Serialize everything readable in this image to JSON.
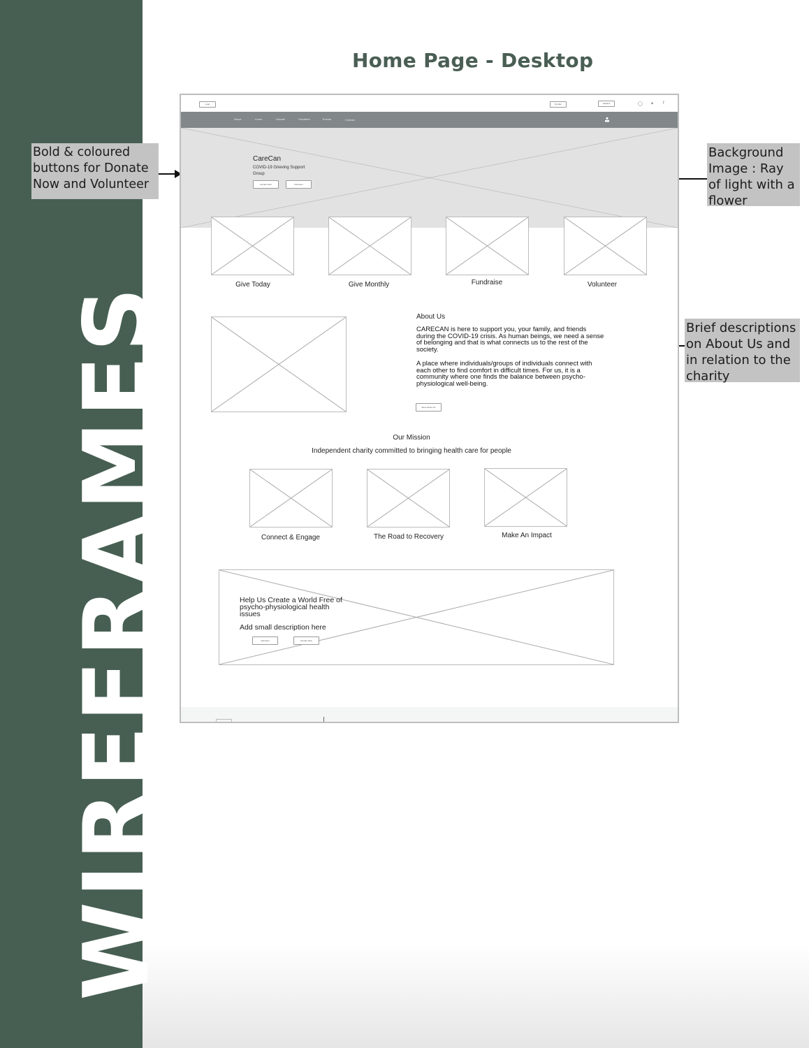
{
  "sidebar": {
    "word": "WIREFRAMES",
    "color": "#475f52"
  },
  "page_title": "Home Page - Desktop",
  "annotations": {
    "buttons_note": "Bold & coloured buttons for Donate Now and Volunteer",
    "background_note": "Background Image : Ray of light with a flower",
    "about_note": "Brief descriptions on About Us and in relation to the charity"
  },
  "wireframe": {
    "header": {
      "logo_label": "Logo",
      "donate_label": "Donate",
      "helpline_label": "Helpline",
      "social_icons": [
        "instagram-icon",
        "twitter-icon",
        "facebook-icon"
      ]
    },
    "nav": {
      "items": [
        "About",
        "Learn",
        "Donate",
        "Volunteer",
        "Events",
        "Contact"
      ]
    },
    "hero": {
      "title": "CareCan",
      "subtitle": "COVID-19 Grieving Support Group",
      "donate_btn": "Donate Now",
      "volunteer_btn": "Volunteer"
    },
    "cards": [
      {
        "label": "Give Today"
      },
      {
        "label": "Give Monthly"
      },
      {
        "label": "Fundraise"
      },
      {
        "label": "Volunteer"
      }
    ],
    "about": {
      "title": "About Us",
      "p1": "CARECAN is here to support you, your family, and friends during the COVID-19 crisis. As human beings, we need a sense of belonging and that is what connects us to the rest of the society.",
      "p2": "A place where individuals/groups of individuals connect with each other to find comfort in difficult times. For us, it is a community where one finds the balance between psycho-physiological well-being.",
      "more_btn": "More About Us"
    },
    "mission": {
      "title": "Our Mission",
      "subtitle": "Independent charity committed to bringing health care for people",
      "items": [
        {
          "label": "Connect & Engage"
        },
        {
          "label": "The Road to Recovery"
        },
        {
          "label": "Make An Impact"
        }
      ]
    },
    "cta": {
      "title": "Help Us Create a World Free of psycho-physiological health issues",
      "description": "Add small description here",
      "volunteer_btn": "Volunteer",
      "donate_btn": "Donate Now"
    }
  }
}
